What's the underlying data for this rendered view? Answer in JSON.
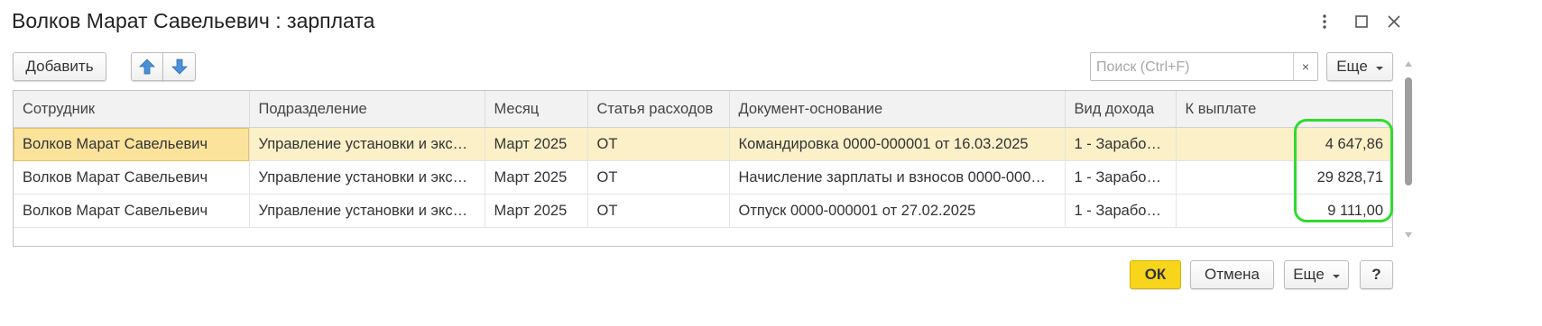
{
  "window": {
    "title": "Волков Марат Савельевич : зарплата"
  },
  "toolbar": {
    "add_label": "Добавить",
    "search_placeholder": "Поиск (Ctrl+F)",
    "search_clear": "×",
    "more_label": "Еще"
  },
  "table": {
    "columns": [
      "Сотрудник",
      "Подразделение",
      "Месяц",
      "Статья расходов",
      "Документ-основание",
      "Вид дохода",
      "К выплате"
    ],
    "rows": [
      [
        "Волков Марат Савельевич",
        "Управление установки и экс…",
        "Март 2025",
        "ОТ",
        "Командировка 0000-000001 от 16.03.2025",
        "1 - Зарабо…",
        "4 647,86"
      ],
      [
        "Волков Марат Савельевич",
        "Управление установки и экс…",
        "Март 2025",
        "ОТ",
        "Начисление зарплаты и взносов 0000-000…",
        "1 - Зарабо…",
        "29 828,71"
      ],
      [
        "Волков Марат Савельевич",
        "Управление установки и экс…",
        "Март 2025",
        "ОТ",
        "Отпуск 0000-000001 от 27.02.2025",
        "1 - Зарабо…",
        "9 111,00"
      ]
    ]
  },
  "footer": {
    "ok_label": "ОК",
    "cancel_label": "Отмена",
    "more_label": "Еще",
    "help_label": "?"
  },
  "colors": {
    "accent_ok": "#f7d51b",
    "selected_row": "#fbf0c7",
    "highlight": "#2fdc2f",
    "arrow": "#4a90d9"
  }
}
